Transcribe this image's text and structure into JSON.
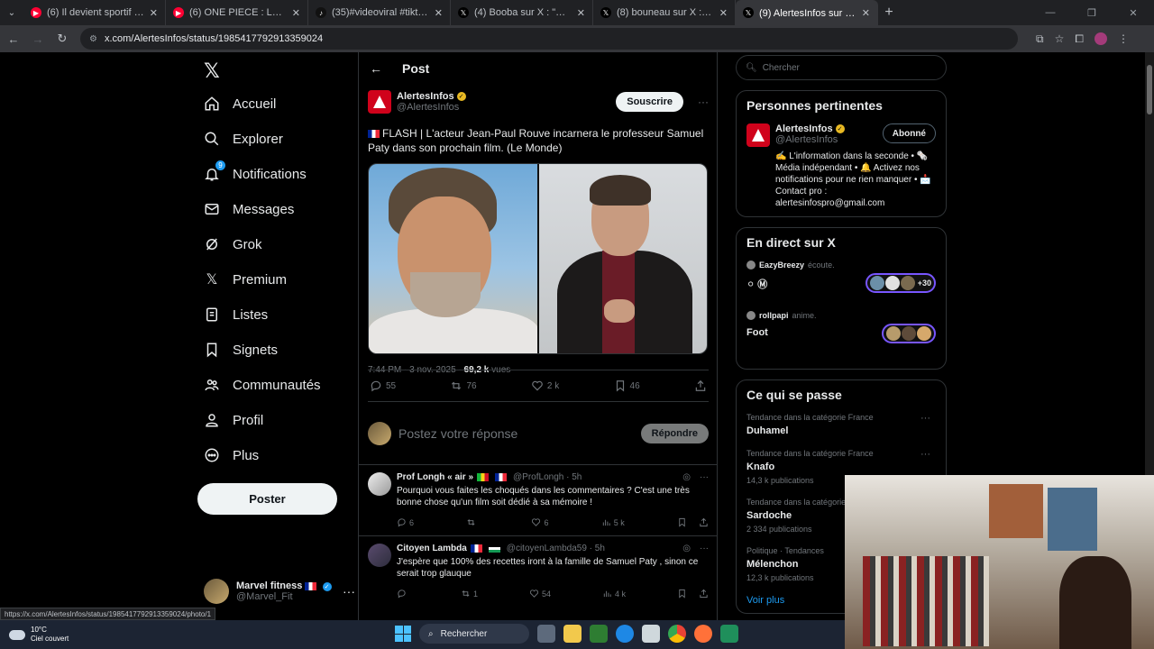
{
  "browser": {
    "tabs": [
      {
        "title": "(6) Il devient sportif de haut ni…",
        "color": "#ff0033",
        "active": false
      },
      {
        "title": "(6) ONE PIECE : LA PRISON D'E…",
        "color": "#ff0033",
        "active": false
      },
      {
        "title": "(35)#videoviral #tiktokviral #ha…",
        "color": "#111111",
        "active": false
      },
      {
        "title": "(4) Booba sur X : \"@KaarisOffic…",
        "color": "#000000",
        "active": false
      },
      {
        "title": "(8) bouneau sur X : \"@booba M…",
        "color": "#000000",
        "active": false
      },
      {
        "title": "(9) AlertesInfos sur X : \"🇫🇷 FLASH…",
        "color": "#000000",
        "active": true
      }
    ],
    "url": "x.com/AlertesInfos/status/1985417792913359024",
    "status_url": "https://x.com/AlertesInfos/status/1985417792913359024/photo/1"
  },
  "sidebar": {
    "items": [
      {
        "label": "Accueil",
        "icon": "home-icon"
      },
      {
        "label": "Explorer",
        "icon": "search-icon"
      },
      {
        "label": "Notifications",
        "icon": "bell-icon",
        "badge": "9"
      },
      {
        "label": "Messages",
        "icon": "mail-icon"
      },
      {
        "label": "Grok",
        "icon": "grok-icon"
      },
      {
        "label": "Premium",
        "icon": "x-logo-icon"
      },
      {
        "label": "Listes",
        "icon": "list-icon"
      },
      {
        "label": "Signets",
        "icon": "bookmark-icon"
      },
      {
        "label": "Communautés",
        "icon": "communities-icon"
      },
      {
        "label": "Profil",
        "icon": "person-icon"
      },
      {
        "label": "Plus",
        "icon": "more-circle-icon"
      }
    ],
    "post_button": "Poster",
    "account": {
      "name": "Marvel fitness",
      "handle": "@Marvel_Fit"
    }
  },
  "main": {
    "title": "Post",
    "tweet": {
      "author": "AlertesInfos",
      "handle": "@AlertesInfos",
      "subscribe": "Souscrire",
      "text": "FLASH | L'acteur Jean-Paul Rouve incarnera le professeur Samuel Paty dans son prochain film. (Le Monde)",
      "time": "7:44 PM · 3 nov. 2025 · ",
      "views": "69,2 k",
      "views_label": " vues",
      "replies": "55",
      "reposts": "76",
      "likes": "2 k",
      "bookmarks": "46"
    },
    "reply_placeholder": "Postez votre réponse",
    "reply_button": "Répondre",
    "replies": [
      {
        "name": "Prof Longh « air »",
        "handle": "@ProfLongh · 5h",
        "text": "Pourquoi vous faites les choqués dans les commentaires ? C'est une très bonne chose qu'un film soit dédié à sa mémoire !",
        "replies": "6",
        "reposts": "",
        "likes": "6",
        "views": "5 k"
      },
      {
        "name": "Citoyen Lambda",
        "handle": "@citoyenLambda59 · 5h",
        "text": "J'espère que 100% des recettes iront à la famille de Samuel Paty , sinon ce serait trop glauque",
        "replies": "",
        "reposts": "1",
        "likes": "54",
        "views": "4 k"
      }
    ]
  },
  "right": {
    "search_placeholder": "Chercher",
    "related": {
      "title": "Personnes pertinentes",
      "name": "AlertesInfos",
      "handle": "@AlertesInfos",
      "button": "Abonné",
      "bio": "✍️ L'information dans la seconde • 🗞️ Média indépendant • 🔔 Activez nos notifications pour ne rien manquer • 📩 Contact pro : alertesinfospro@gmail.com"
    },
    "live": {
      "title": "En direct sur X",
      "items": [
        {
          "user": "EazyBreezy",
          "action": "écoute.",
          "title": "",
          "count": "+30"
        },
        {
          "user": "rollpapi",
          "action": "anime.",
          "title": "Foot",
          "count": ""
        }
      ]
    },
    "trends": {
      "title": "Ce qui se passe",
      "items": [
        {
          "category": "Tendance dans la catégorie France",
          "name": "Duhamel",
          "count": ""
        },
        {
          "category": "Tendance dans la catégorie France",
          "name": "Knafo",
          "count": "14,3 k publications"
        },
        {
          "category": "Tendance dans la catégorie",
          "name": "Sardoche",
          "count": "2 334 publications"
        },
        {
          "category": "Politique · Tendances",
          "name": "Mélenchon",
          "count": "12,3 k publications"
        }
      ],
      "see_more": "Voir plus"
    }
  },
  "taskbar": {
    "temperature": "10°C",
    "weather": "Ciel couvert",
    "search": "Rechercher"
  }
}
